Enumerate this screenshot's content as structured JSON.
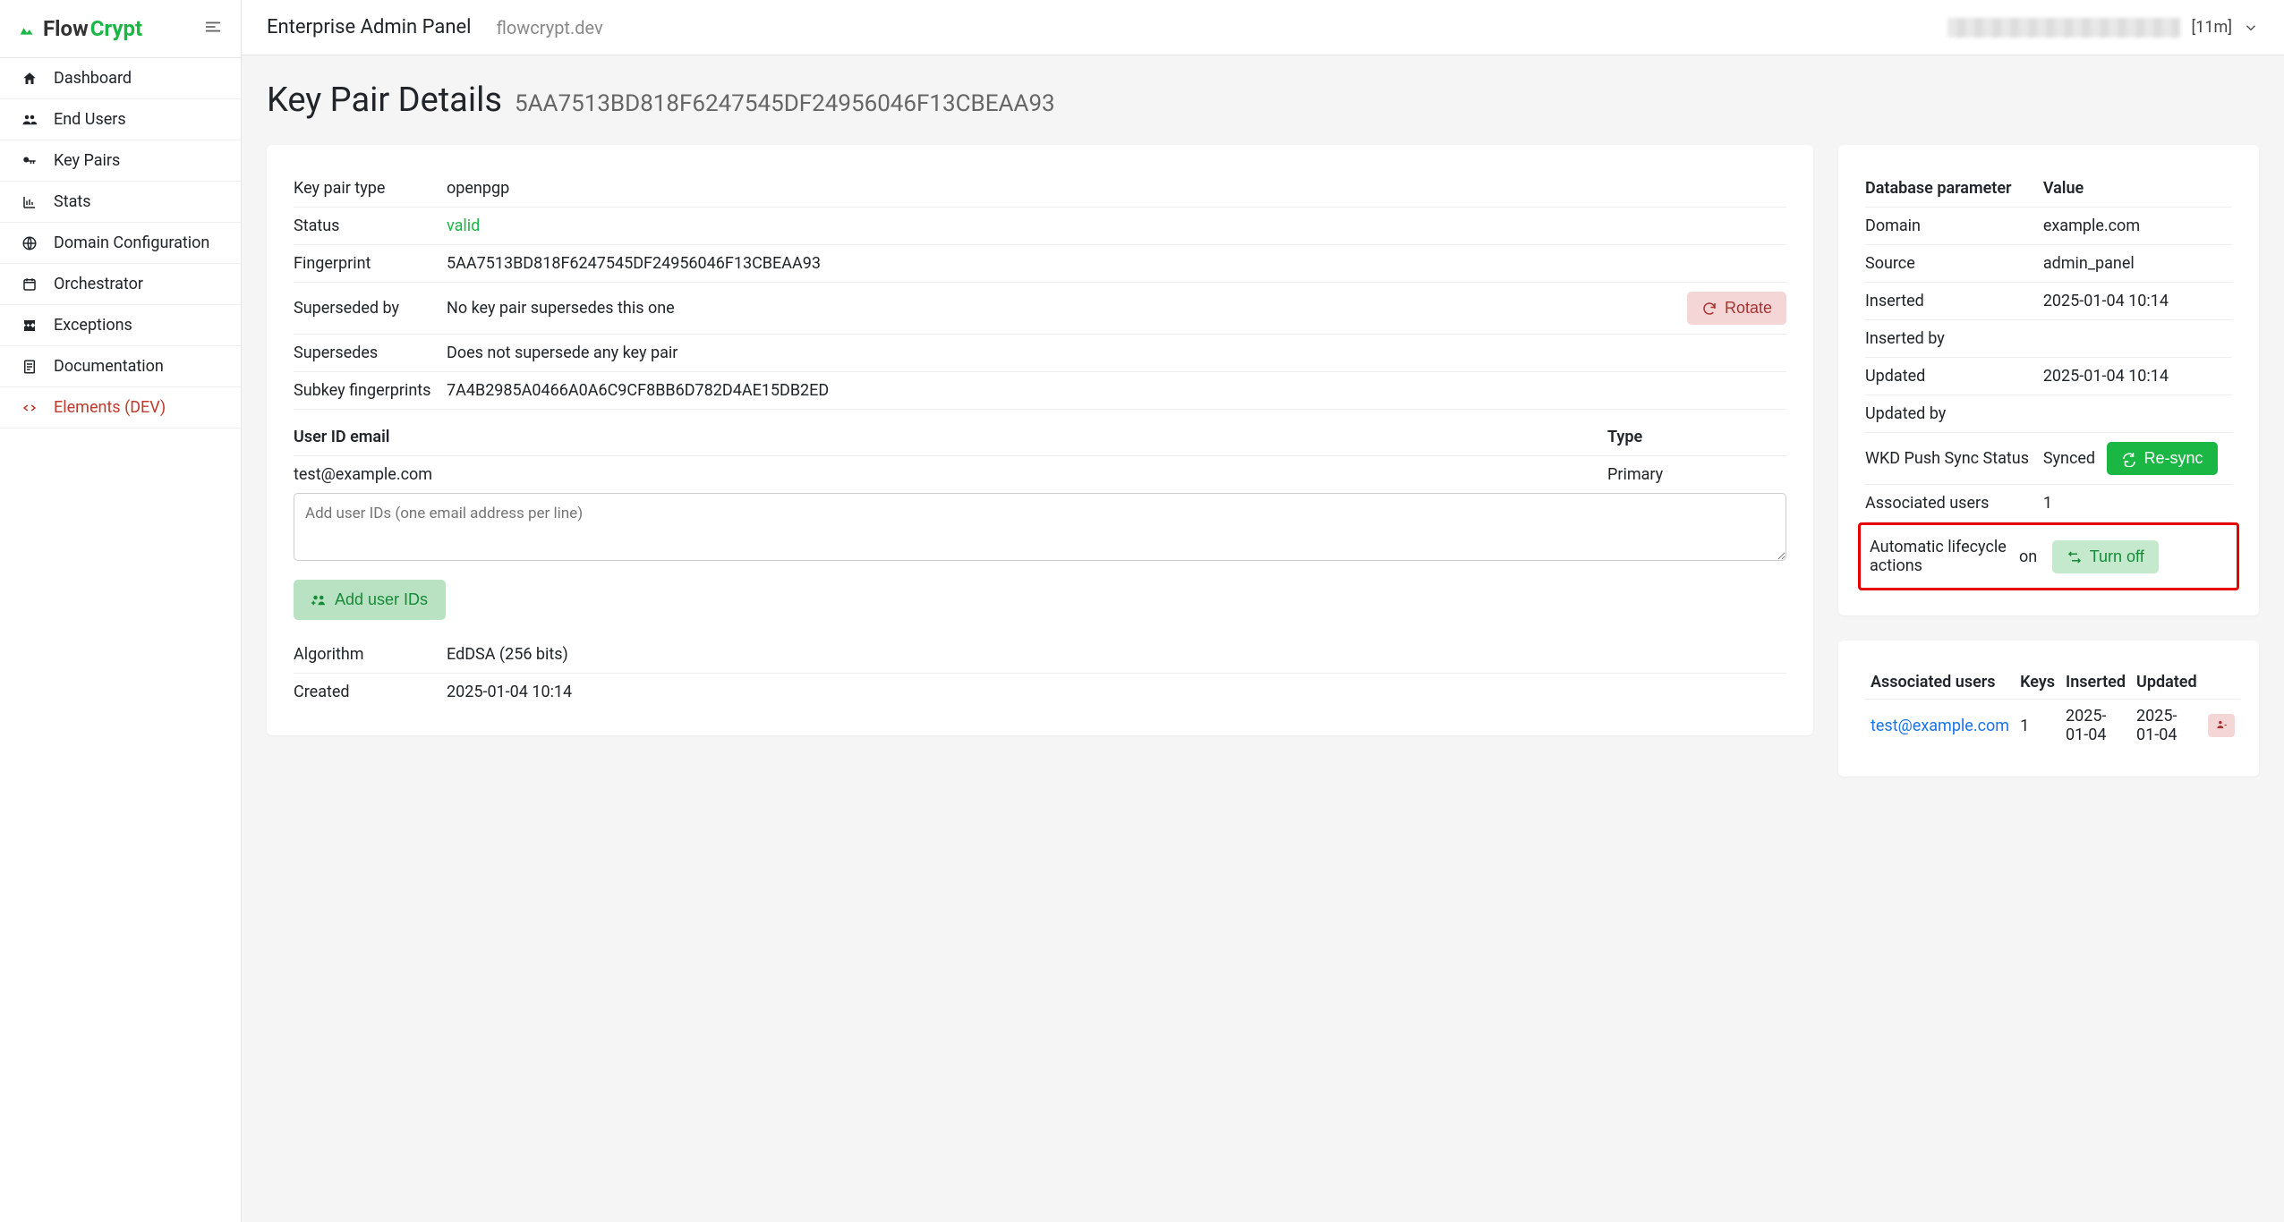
{
  "brand": {
    "flow": "Flow",
    "crypt": "Crypt"
  },
  "topbar": {
    "title": "Enterprise Admin Panel",
    "domain": "flowcrypt.dev",
    "session": "[11m]"
  },
  "sidebar": {
    "items": [
      {
        "label": "Dashboard",
        "icon": "home"
      },
      {
        "label": "End Users",
        "icon": "users"
      },
      {
        "label": "Key Pairs",
        "icon": "key"
      },
      {
        "label": "Stats",
        "icon": "chart"
      },
      {
        "label": "Domain Configuration",
        "icon": "globe"
      },
      {
        "label": "Orchestrator",
        "icon": "calendar"
      },
      {
        "label": "Exceptions",
        "icon": "broken"
      },
      {
        "label": "Documentation",
        "icon": "doc"
      },
      {
        "label": "Elements (DEV)",
        "icon": "code",
        "dev": true
      }
    ]
  },
  "page": {
    "heading": "Key Pair Details",
    "fingerprint": "5AA7513BD818F6247545DF24956046F13CBEAA93"
  },
  "details": {
    "type_label": "Key pair type",
    "type_value": "openpgp",
    "status_label": "Status",
    "status_value": "valid",
    "fingerprint_label": "Fingerprint",
    "fingerprint_value": "5AA7513BD818F6247545DF24956046F13CBEAA93",
    "superseded_label": "Superseded by",
    "superseded_value": "No key pair supersedes this one",
    "rotate_label": "Rotate",
    "supersedes_label": "Supersedes",
    "supersedes_value": "Does not supersede any key pair",
    "subkey_label": "Subkey fingerprints",
    "subkey_value": "7A4B2985A0466A0A6C9CF8BB6D782D4AE15DB2ED",
    "algorithm_label": "Algorithm",
    "algorithm_value": "EdDSA (256 bits)",
    "created_label": "Created",
    "created_value": "2025-01-04 10:14"
  },
  "userids": {
    "header_email": "User ID email",
    "header_type": "Type",
    "rows": [
      {
        "email": "test@example.com",
        "type": "Primary"
      }
    ],
    "placeholder": "Add user IDs (one email address per line)",
    "add_button": "Add user IDs"
  },
  "dbparams": {
    "header_param": "Database parameter",
    "header_value": "Value",
    "domain_label": "Domain",
    "domain_value": "example.com",
    "source_label": "Source",
    "source_value": "admin_panel",
    "inserted_label": "Inserted",
    "inserted_value": "2025-01-04 10:14",
    "inserted_by_label": "Inserted by",
    "updated_label": "Updated",
    "updated_value": "2025-01-04 10:14",
    "updated_by_label": "Updated by",
    "wkd_label": "WKD Push Sync Status",
    "wkd_value": "Synced",
    "resync_label": "Re-sync",
    "assoc_label": "Associated users",
    "assoc_value": "1",
    "lifecycle_label": "Automatic lifecycle actions",
    "lifecycle_value": "on",
    "turnoff_label": "Turn off"
  },
  "assoc_users": {
    "headers": {
      "users": "Associated users",
      "keys": "Keys",
      "inserted": "Inserted",
      "updated": "Updated"
    },
    "rows": [
      {
        "email": "test@example.com",
        "keys": "1",
        "inserted": "2025-01-04",
        "updated": "2025-01-04"
      }
    ]
  }
}
